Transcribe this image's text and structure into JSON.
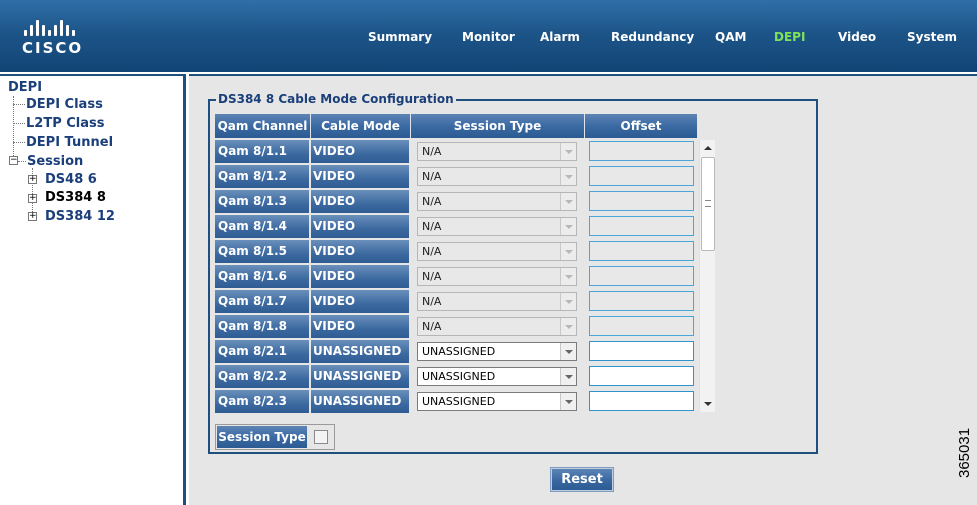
{
  "brand": {
    "logo_text": "CISCO"
  },
  "nav": {
    "items": [
      {
        "label": "Summary"
      },
      {
        "label": "Monitor"
      },
      {
        "label": "Alarm"
      },
      {
        "label": "Redundancy"
      },
      {
        "label": "QAM"
      },
      {
        "label": "DEPI",
        "active": true
      },
      {
        "label": "Video"
      },
      {
        "label": "System"
      }
    ]
  },
  "sidebar": {
    "root": "DEPI",
    "items": [
      {
        "label": "DEPI Class"
      },
      {
        "label": "L2TP Class"
      },
      {
        "label": "DEPI Tunnel"
      },
      {
        "label": "Session"
      }
    ],
    "session_children": [
      {
        "label": "DS48 6"
      },
      {
        "label": "DS384 8",
        "selected": true
      },
      {
        "label": "DS384 12"
      }
    ]
  },
  "config": {
    "title": "DS384 8 Cable Mode Configuration",
    "columns": [
      "Qam Channel",
      "Cable Mode",
      "Session Type",
      "Offset"
    ],
    "rows": [
      {
        "channel": "Qam 8/1.1",
        "mode": "VIDEO",
        "session": "N/A",
        "enabled": false
      },
      {
        "channel": "Qam 8/1.2",
        "mode": "VIDEO",
        "session": "N/A",
        "enabled": false
      },
      {
        "channel": "Qam 8/1.3",
        "mode": "VIDEO",
        "session": "N/A",
        "enabled": false
      },
      {
        "channel": "Qam 8/1.4",
        "mode": "VIDEO",
        "session": "N/A",
        "enabled": false
      },
      {
        "channel": "Qam 8/1.5",
        "mode": "VIDEO",
        "session": "N/A",
        "enabled": false
      },
      {
        "channel": "Qam 8/1.6",
        "mode": "VIDEO",
        "session": "N/A",
        "enabled": false
      },
      {
        "channel": "Qam 8/1.7",
        "mode": "VIDEO",
        "session": "N/A",
        "enabled": false
      },
      {
        "channel": "Qam 8/1.8",
        "mode": "VIDEO",
        "session": "N/A",
        "enabled": false
      },
      {
        "channel": "Qam 8/2.1",
        "mode": "UNASSIGNED",
        "session": "UNASSIGNED",
        "enabled": true
      },
      {
        "channel": "Qam 8/2.2",
        "mode": "UNASSIGNED",
        "session": "UNASSIGNED",
        "enabled": true
      },
      {
        "channel": "Qam 8/2.3",
        "mode": "UNASSIGNED",
        "session": "UNASSIGNED",
        "enabled": true
      }
    ],
    "session_type_label": "Session Type",
    "reset_label": "Reset"
  },
  "figure_id": "365031"
}
